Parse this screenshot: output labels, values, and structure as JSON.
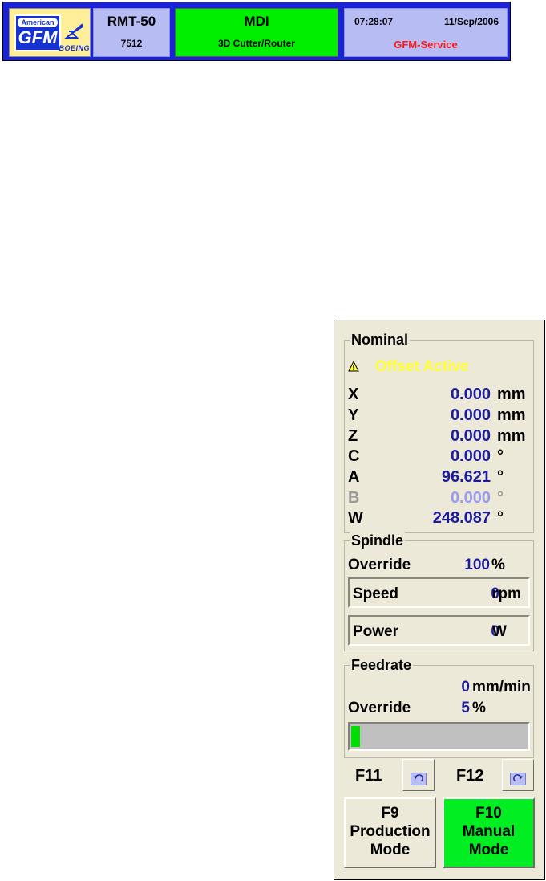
{
  "header": {
    "logo": {
      "american": "American",
      "gfm": "GFM",
      "boeing": "BOEING"
    },
    "machine": {
      "name": "RMT-50",
      "number": "7512"
    },
    "mode": {
      "name": "MDI",
      "description": "3D Cutter/Router"
    },
    "clock": {
      "time": "07:28:07",
      "date": "11/Sep/2006",
      "user": "GFM-Service"
    },
    "colors": {
      "bar": "#1a22d8",
      "mode_active": "#00ee00",
      "user": "#ff1a1a"
    }
  },
  "panel": {
    "nominal": {
      "title": "Nominal",
      "status": "Offset Active",
      "status_icon": "warning-icon",
      "axes": [
        {
          "label": "X",
          "value": "0.000",
          "unit": "mm",
          "enabled": true
        },
        {
          "label": "Y",
          "value": "0.000",
          "unit": "mm",
          "enabled": true
        },
        {
          "label": "Z",
          "value": "0.000",
          "unit": "mm",
          "enabled": true
        },
        {
          "label": "C",
          "value": "0.000",
          "unit": "°",
          "enabled": true
        },
        {
          "label": "A",
          "value": "96.621",
          "unit": "°",
          "enabled": true
        },
        {
          "label": "B",
          "value": "0.000",
          "unit": "°",
          "enabled": false
        },
        {
          "label": "W",
          "value": "248.087",
          "unit": "°",
          "enabled": true
        }
      ]
    },
    "spindle": {
      "title": "Spindle",
      "override_label": "Override",
      "override_value": "100",
      "override_unit": "%",
      "speed_label": "Speed",
      "speed_value": "0",
      "speed_unit": "rpm",
      "power_label": "Power",
      "power_value": "0",
      "power_unit": "W"
    },
    "feedrate": {
      "title": "Feedrate",
      "value": "0",
      "unit": "mm/min",
      "override_label": "Override",
      "override_value": "5",
      "override_unit": "%",
      "override_fraction": 0.05
    },
    "keys": {
      "f11_label": "F11",
      "f11_icon": "undo-icon",
      "f12_label": "F12",
      "f12_icon": "redo-icon",
      "f9": {
        "key": "F9",
        "line1": "Production",
        "line2": "Mode"
      },
      "f10": {
        "key": "F10",
        "line1": "Manual",
        "line2": "Mode"
      }
    }
  }
}
